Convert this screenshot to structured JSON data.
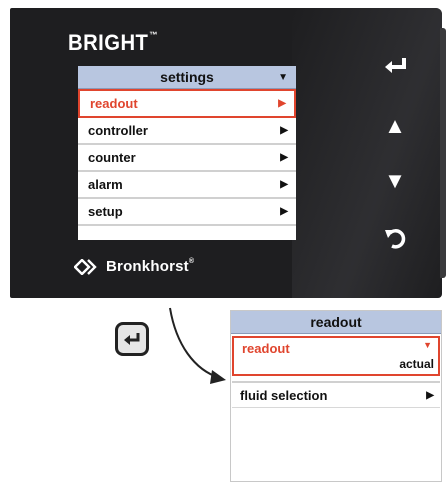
{
  "device": {
    "brand": "BRIGHT",
    "brand_mark": "™",
    "manufacturer": "Bronkhorst",
    "manufacturer_mark": "®"
  },
  "screen": {
    "title": "settings",
    "title_caret": "▼",
    "items": [
      {
        "label": "readout",
        "arrow": "▶",
        "selected": true
      },
      {
        "label": "controller",
        "arrow": "▶",
        "selected": false
      },
      {
        "label": "counter",
        "arrow": "▶",
        "selected": false
      },
      {
        "label": "alarm",
        "arrow": "▶",
        "selected": false
      },
      {
        "label": "setup",
        "arrow": "▶",
        "selected": false
      }
    ]
  },
  "side_buttons": {
    "enter": "↵",
    "up": "▲",
    "down": "▼",
    "back": "↶"
  },
  "panel": {
    "title": "readout",
    "selected_label": "readout",
    "selected_caret": "▼",
    "selected_value": "actual",
    "items": [
      {
        "label": "fluid selection",
        "arrow": "▶"
      }
    ]
  },
  "colors": {
    "accent": "#e0452e",
    "header_bg": "#b8c6e0",
    "device_body": "#1e1e20"
  },
  "icons": [
    "enter-icon",
    "up-triangle-icon",
    "down-triangle-icon",
    "back-icon",
    "bronkhorst-logo-icon",
    "curved-arrow-icon"
  ]
}
